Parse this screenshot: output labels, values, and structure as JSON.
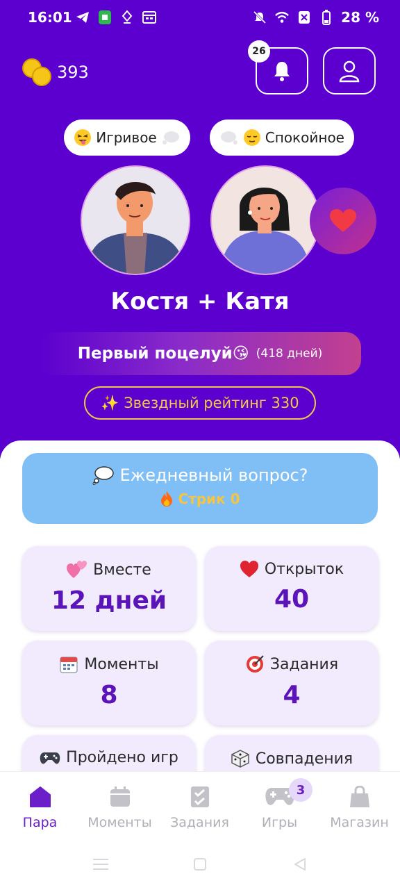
{
  "status_bar": {
    "time": "16:01",
    "battery": "28 %"
  },
  "header": {
    "coins": "393",
    "notifications_count": "26"
  },
  "moods": [
    {
      "label": "Игривое"
    },
    {
      "label": "Спокойное"
    }
  ],
  "couple": {
    "names": "Костя + Катя"
  },
  "milestone": {
    "title": "Первый поцелуй😘",
    "days": "(418 дней)"
  },
  "rating": {
    "label": "✨ Звездный рейтинг 330"
  },
  "daily": {
    "question": "Ежедневный вопрос?",
    "streak": "Стрик 0"
  },
  "stats": [
    {
      "label": "Вместе",
      "value": "12 дней"
    },
    {
      "label": "Открыток",
      "value": "40"
    },
    {
      "label": "Моменты",
      "value": "8"
    },
    {
      "label": "Задания",
      "value": "4"
    },
    {
      "label": "Пройдено игр",
      "value": ""
    },
    {
      "label": "Совпадения",
      "value": ""
    }
  ],
  "nav": {
    "items": [
      {
        "label": "Пара"
      },
      {
        "label": "Моменты"
      },
      {
        "label": "Задания"
      },
      {
        "label": "Игры"
      },
      {
        "label": "Магазин"
      }
    ],
    "games_badge": "3"
  },
  "colors": {
    "primary": "#5b00cf",
    "accent_purple": "#6a1fc9",
    "daily_blue": "#7fbff5",
    "gold": "#f5c842",
    "card_bg": "#f2ebfd"
  }
}
